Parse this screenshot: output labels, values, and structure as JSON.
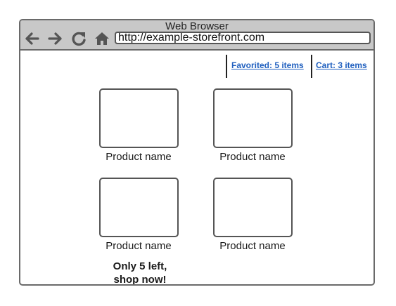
{
  "window": {
    "title": "Web Browser"
  },
  "toolbar": {
    "back_icon": "arrow-left-icon",
    "forward_icon": "arrow-right-icon",
    "reload_icon": "reload-icon",
    "home_icon": "home-icon",
    "url": "http://example-storefront.com"
  },
  "header": {
    "favorited_link": "Favorited: 5 items",
    "cart_link": "Cart: 3 items"
  },
  "products": [
    {
      "name": "Product name"
    },
    {
      "name": "Product name"
    },
    {
      "name": "Product name"
    },
    {
      "name": "Product name"
    }
  ],
  "promo": {
    "line1": "Only 5 left,",
    "line2": "shop now!"
  },
  "colors": {
    "titlebar": "#c8c8c8",
    "border": "#6a6a6a",
    "link": "#1f5fbf"
  }
}
